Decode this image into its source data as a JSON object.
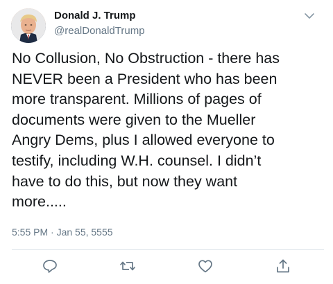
{
  "author": {
    "name": "Donald J. Trump",
    "handle": "@realDonaldTrump"
  },
  "tweet": {
    "text": "No Collusion, No Obstruction - there has\nNEVER been a President who has been\nmore transparent. Millions of pages of\ndocuments were given to the Mueller\nAngry Dems, plus I allowed everyone to\ntestify, including W.H. counsel. I didn’t\nhave to do this, but now they want\nmore.....",
    "timestamp": "5:55 PM · Jan 55, 5555"
  },
  "actions": [
    {
      "icon": "reply-icon"
    },
    {
      "icon": "retweet-icon"
    },
    {
      "icon": "like-icon"
    },
    {
      "icon": "share-icon"
    }
  ],
  "colors": {
    "text": "#14171a",
    "secondary": "#657786",
    "divider": "#e1e8ed"
  }
}
